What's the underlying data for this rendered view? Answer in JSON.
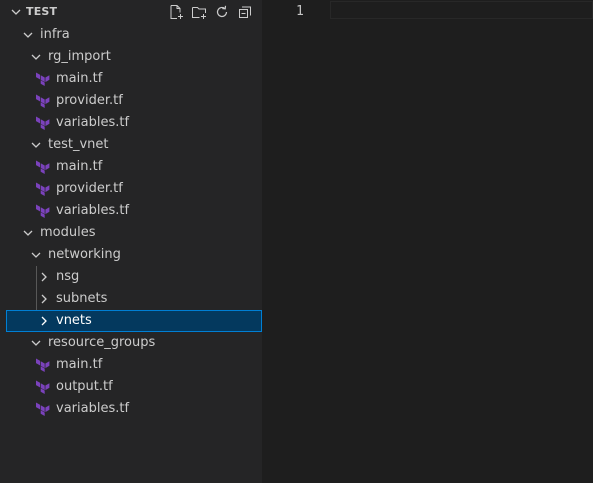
{
  "explorer": {
    "title": "TEST",
    "actions": [
      "new-file-icon",
      "new-folder-icon",
      "refresh-icon",
      "collapse-all-icon"
    ]
  },
  "tree": {
    "infra": "infra",
    "rg_import": "rg_import",
    "rg_main": "main.tf",
    "rg_provider": "provider.tf",
    "rg_variables": "variables.tf",
    "test_vnet": "test_vnet",
    "tv_main": "main.tf",
    "tv_provider": "provider.tf",
    "tv_variables": "variables.tf",
    "modules": "modules",
    "networking": "networking",
    "nsg": "nsg",
    "subnets": "subnets",
    "vnets": "vnets",
    "resource_groups": "resource_groups",
    "rgp_main": "main.tf",
    "rgp_output": "output.tf",
    "rgp_variables": "variables.tf"
  },
  "editor": {
    "line_number": "1"
  },
  "colors": {
    "terraform_icon": "#7b42bc",
    "selection_bg": "#04395e",
    "selection_border": "#007fd4"
  }
}
